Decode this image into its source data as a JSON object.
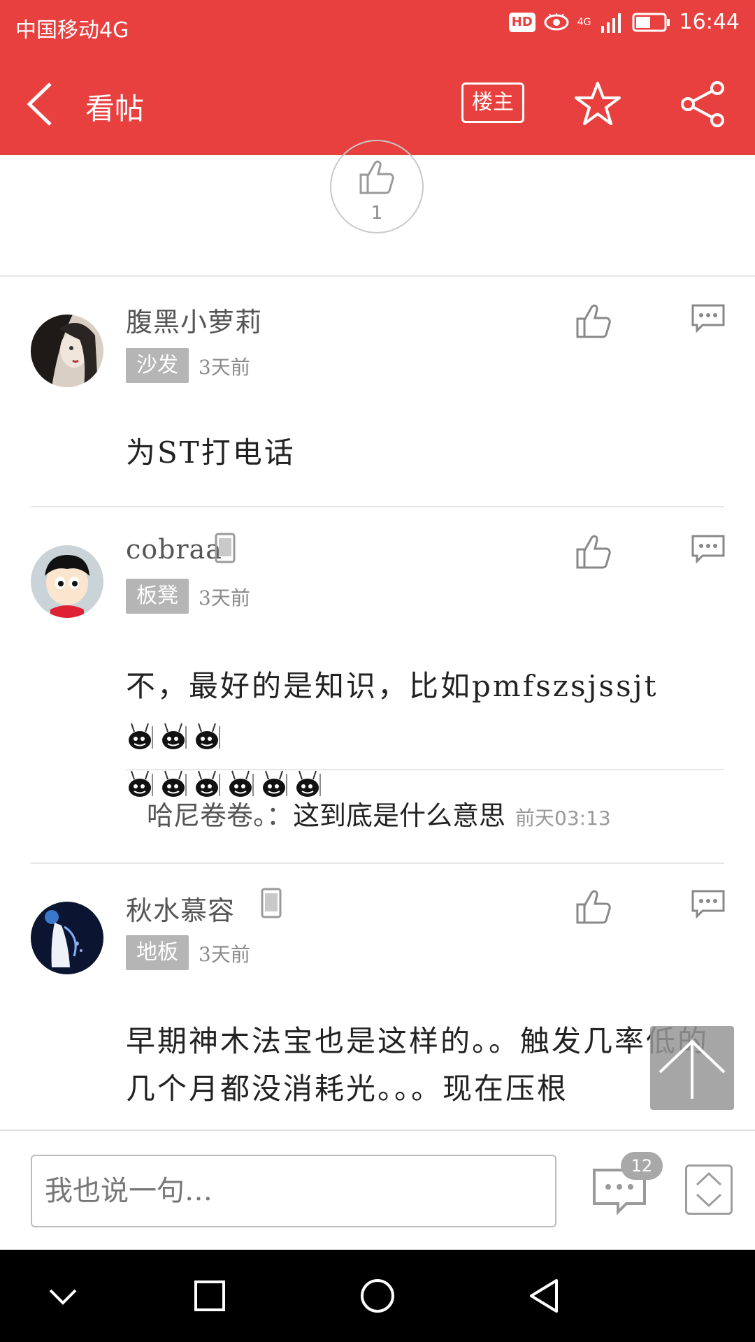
{
  "status_bar": {
    "carrier": "中国移动4G",
    "hd": "HD",
    "network": "4G",
    "time": "16:44"
  },
  "header": {
    "title": "看帖",
    "owner_button": "楼主"
  },
  "top_like": {
    "count": "1"
  },
  "posts": [
    {
      "username": "腹黑小萝莉",
      "floor": "沙发",
      "time": "3天前",
      "content": "为ST打电话"
    },
    {
      "username": "cobraa",
      "floor": "板凳",
      "time": "3天前",
      "content": "不，最好的是知识，比如pmfszsjssjt"
    },
    {
      "username": "秋水慕容",
      "floor": "地板",
      "time": "3天前",
      "content": "早期神木法宝也是这样的。。触发几率低的几个月都没消耗光。。。现在压根"
    }
  ],
  "subreply": {
    "user": "哈尼卷卷。：",
    "text": "这到底是什么意思",
    "time": "前天03:13"
  },
  "bottom_bar": {
    "placeholder": "我也说一句…",
    "comment_count": "12"
  },
  "colors": {
    "brand": "#e8403e",
    "badge": "#b5b5b5"
  }
}
